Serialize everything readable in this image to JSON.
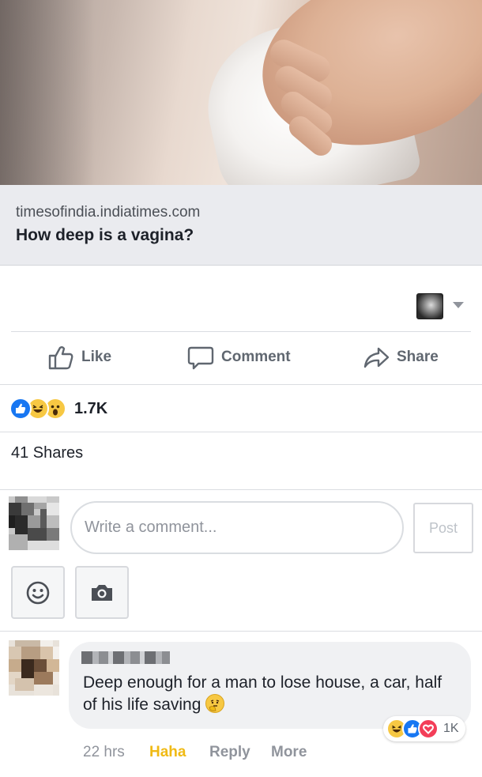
{
  "link_preview": {
    "domain": "timesofindia.indiatimes.com",
    "title": "How deep is a vagina?"
  },
  "actions": {
    "like_label": "Like",
    "comment_label": "Comment",
    "share_label": "Share"
  },
  "reactions": {
    "types": [
      "like",
      "haha",
      "wow"
    ],
    "count": "1.7K"
  },
  "shares_text": "41 Shares",
  "composer": {
    "placeholder": "Write a comment...",
    "post_label": "Post",
    "tools": [
      "smiley-icon",
      "camera-icon"
    ]
  },
  "comment": {
    "text": "Deep enough for a man to lose house, a car, half of his life saving",
    "emoji": "thinking-face",
    "reactions": {
      "types": [
        "haha",
        "like",
        "love"
      ],
      "count": "1K"
    },
    "time": "22 hrs",
    "reaction_label": "Haha",
    "reply_label": "Reply",
    "more_label": "More"
  },
  "colors": {
    "link_bg": "#eaebef",
    "action_gray": "#606770",
    "like_blue": "#1877f2",
    "haha_yellow": "#f7c843",
    "love_red": "#f33e58",
    "haha_label": "#f0ba15"
  }
}
